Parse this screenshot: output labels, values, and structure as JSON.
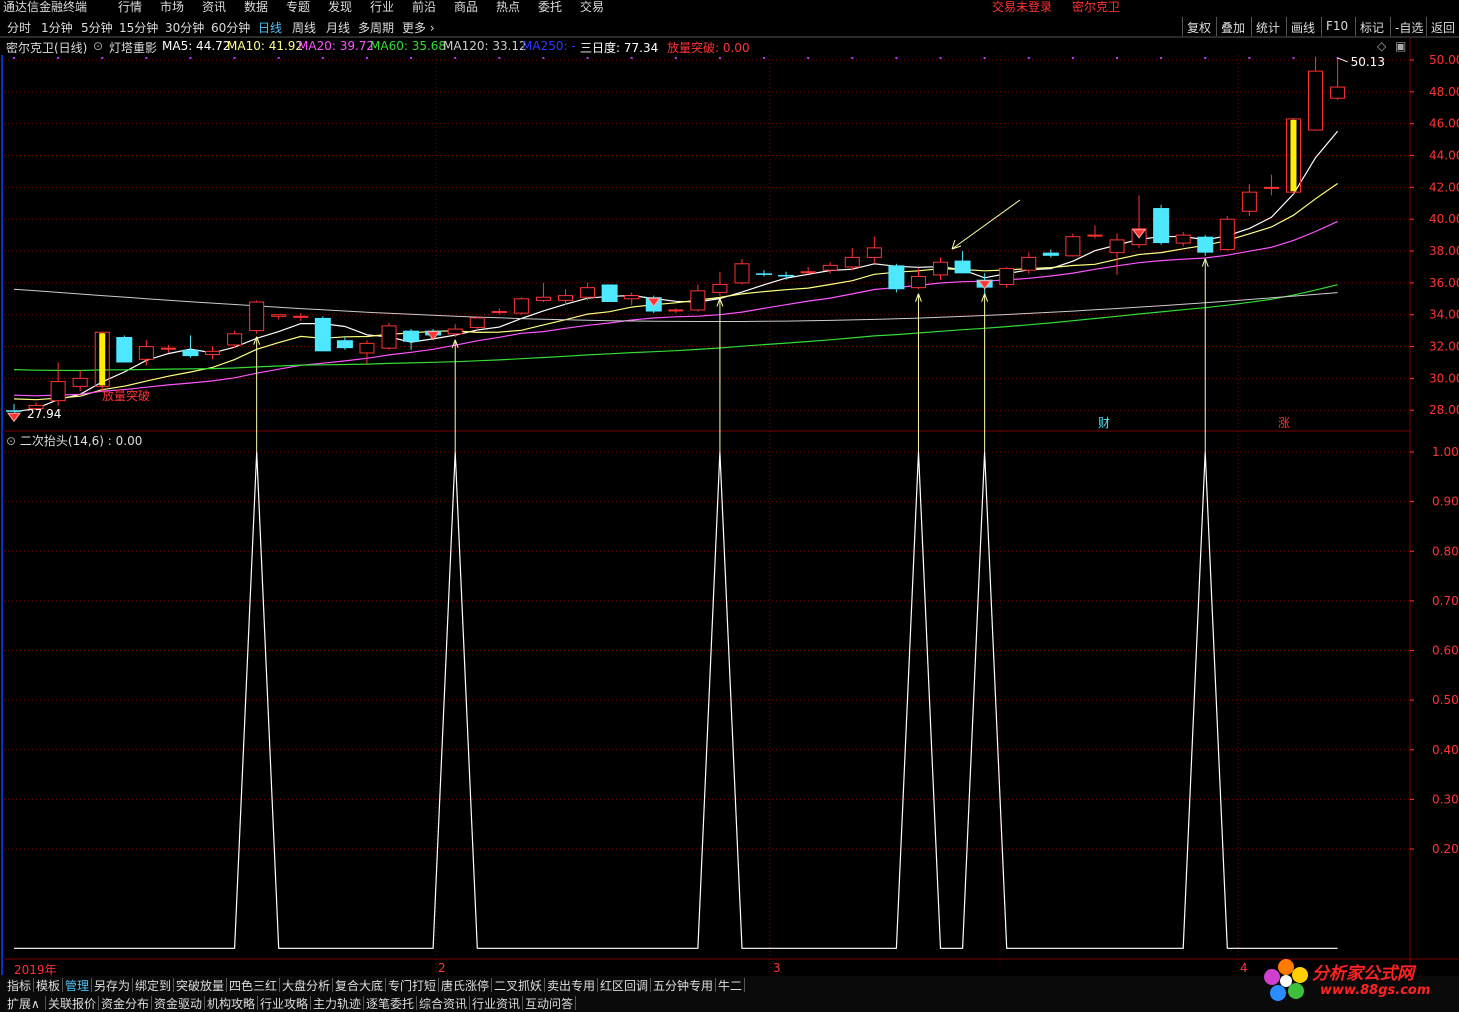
{
  "app": {
    "title": "通达信金融终端"
  },
  "menu": [
    "行情",
    "市场",
    "资讯",
    "数据",
    "专题",
    "发现",
    "行业",
    "前沿",
    "商品",
    "热点",
    "委托",
    "交易"
  ],
  "status": {
    "login": "交易未登录",
    "stock": "密尔克卫"
  },
  "periods": [
    "分时",
    "1分钟",
    "5分钟",
    "15分钟",
    "30分钟",
    "60分钟",
    "日线",
    "周线",
    "月线",
    "多周期",
    "更多 ›"
  ],
  "active_period": "日线",
  "right_tools": [
    "复权",
    "叠加",
    "统计",
    "画线",
    "F10",
    "标记",
    "-自选",
    "返回"
  ],
  "info": {
    "stock_label": "密尔克卫(日线)",
    "indicator_name": "灯塔重影",
    "ma5": "MA5: 44.72",
    "ma10": "MA10: 41.92",
    "ma20": "MA20: 39.72",
    "ma60": "MA60: 35.68",
    "ma120": "MA120: 33.12",
    "ma250": "MA250: -",
    "three_day": "三日度: 77.34",
    "breakout": "放量突破: 0.00"
  },
  "colors": {
    "ma5": "#ffffff",
    "ma10": "#ffff80",
    "ma20": "#ff55ff",
    "ma60": "#33dd33",
    "ma120": "#cccccc",
    "ma250": "#2b3bff",
    "up": "#ff3333",
    "down": "#4de8ff",
    "arrow": "#ffffaa",
    "grid": "#7a0000"
  },
  "main_chart": {
    "high_label": "50.13",
    "low_label": "27.94",
    "breakout_label": "放量突破",
    "cai_label": "财",
    "zhang_label": "涨"
  },
  "sub_chart": {
    "label": "二次抬头(14,6) : 0.00"
  },
  "time_axis": [
    "2019年",
    "2",
    "3",
    "4"
  ],
  "tabs_row1": [
    "指标",
    "模板",
    "管理",
    "另存为",
    "绑定到",
    "突破放量",
    "四色三红",
    "大盘分析",
    "复合大底",
    "专门打短",
    "唐氏涨停",
    "二叉抓妖",
    "卖出专用",
    "红区回调",
    "五分钟专用",
    "牛二"
  ],
  "tabs_row2": [
    "扩展∧",
    "关联报价",
    "资金分布",
    "资金驱动",
    "机构攻略",
    "行业攻略",
    "主力轨迹",
    "逐笔委托",
    "综合资讯",
    "行业资讯",
    "互动问答"
  ],
  "watermark": {
    "name": "分析家公式网",
    "url": "www.88gs.com"
  },
  "chart_data": [
    {
      "type": "candlestick",
      "ylim": [
        27,
        50.8
      ],
      "y_ticks": [
        "50.00",
        "48.00",
        "46.00",
        "44.00",
        "42.00",
        "40.00",
        "38.00",
        "36.00",
        "34.00",
        "32.00",
        "30.00",
        "28.00"
      ],
      "candles": [
        {
          "o": 28.0,
          "h": 28.4,
          "l": 27.94,
          "c": 27.9
        },
        {
          "o": 28.1,
          "h": 28.5,
          "l": 28.0,
          "c": 28.3
        },
        {
          "o": 28.6,
          "h": 31.0,
          "l": 28.3,
          "c": 29.8
        },
        {
          "o": 29.5,
          "h": 30.5,
          "l": 29.2,
          "c": 30.0
        },
        {
          "o": 29.5,
          "h": 32.9,
          "l": 29.2,
          "c": 32.9
        },
        {
          "o": 32.6,
          "h": 32.7,
          "l": 31.0,
          "c": 31.0
        },
        {
          "o": 31.2,
          "h": 32.4,
          "l": 30.8,
          "c": 32.0
        },
        {
          "o": 31.9,
          "h": 32.1,
          "l": 31.6,
          "c": 31.9
        },
        {
          "o": 31.8,
          "h": 32.7,
          "l": 31.3,
          "c": 31.4
        },
        {
          "o": 31.5,
          "h": 32.0,
          "l": 31.2,
          "c": 31.7
        },
        {
          "o": 32.1,
          "h": 33.0,
          "l": 31.9,
          "c": 32.8
        },
        {
          "o": 33.0,
          "h": 34.9,
          "l": 32.8,
          "c": 34.8
        },
        {
          "o": 33.9,
          "h": 33.9,
          "l": 33.7,
          "c": 34.0
        },
        {
          "o": 33.9,
          "h": 34.1,
          "l": 33.6,
          "c": 33.9
        },
        {
          "o": 33.8,
          "h": 33.9,
          "l": 31.7,
          "c": 31.7
        },
        {
          "o": 32.4,
          "h": 32.6,
          "l": 31.8,
          "c": 31.9
        },
        {
          "o": 31.6,
          "h": 32.4,
          "l": 30.9,
          "c": 32.2
        },
        {
          "o": 31.9,
          "h": 33.5,
          "l": 31.8,
          "c": 33.3
        },
        {
          "o": 33.0,
          "h": 33.1,
          "l": 31.8,
          "c": 32.3
        },
        {
          "o": 33.0,
          "h": 33.1,
          "l": 32.6,
          "c": 32.7
        },
        {
          "o": 32.8,
          "h": 33.4,
          "l": 32.6,
          "c": 33.1
        },
        {
          "o": 33.2,
          "h": 33.9,
          "l": 32.9,
          "c": 33.8
        },
        {
          "o": 34.2,
          "h": 34.4,
          "l": 34.0,
          "c": 34.2
        },
        {
          "o": 34.1,
          "h": 35.1,
          "l": 34.0,
          "c": 35.0
        },
        {
          "o": 34.9,
          "h": 36.0,
          "l": 34.8,
          "c": 35.1
        },
        {
          "o": 34.9,
          "h": 35.6,
          "l": 34.6,
          "c": 35.2
        },
        {
          "o": 35.1,
          "h": 36.0,
          "l": 34.9,
          "c": 35.7
        },
        {
          "o": 35.9,
          "h": 35.9,
          "l": 34.8,
          "c": 34.8
        },
        {
          "o": 35.0,
          "h": 35.4,
          "l": 34.6,
          "c": 35.2
        },
        {
          "o": 35.1,
          "h": 35.2,
          "l": 34.1,
          "c": 34.2
        },
        {
          "o": 34.3,
          "h": 34.4,
          "l": 34.1,
          "c": 34.3
        },
        {
          "o": 34.3,
          "h": 35.9,
          "l": 34.2,
          "c": 35.5
        },
        {
          "o": 35.4,
          "h": 36.7,
          "l": 35.2,
          "c": 35.9
        },
        {
          "o": 36.0,
          "h": 37.5,
          "l": 35.9,
          "c": 37.2
        },
        {
          "o": 36.6,
          "h": 36.8,
          "l": 36.4,
          "c": 36.5
        },
        {
          "o": 36.5,
          "h": 36.7,
          "l": 36.2,
          "c": 36.4
        },
        {
          "o": 36.7,
          "h": 37.0,
          "l": 36.6,
          "c": 36.7
        },
        {
          "o": 36.8,
          "h": 37.3,
          "l": 36.6,
          "c": 37.1
        },
        {
          "o": 37.0,
          "h": 38.2,
          "l": 36.8,
          "c": 37.6
        },
        {
          "o": 37.6,
          "h": 38.9,
          "l": 37.2,
          "c": 38.2
        },
        {
          "o": 37.1,
          "h": 37.2,
          "l": 35.4,
          "c": 35.6
        },
        {
          "o": 35.7,
          "h": 36.9,
          "l": 35.6,
          "c": 36.4
        },
        {
          "o": 36.5,
          "h": 37.6,
          "l": 36.2,
          "c": 37.3
        },
        {
          "o": 37.4,
          "h": 38.0,
          "l": 36.7,
          "c": 36.6
        },
        {
          "o": 36.2,
          "h": 36.6,
          "l": 35.2,
          "c": 35.7
        },
        {
          "o": 35.9,
          "h": 37.0,
          "l": 35.7,
          "c": 36.9
        },
        {
          "o": 36.8,
          "h": 37.9,
          "l": 36.6,
          "c": 37.6
        },
        {
          "o": 37.9,
          "h": 38.1,
          "l": 37.6,
          "c": 37.7
        },
        {
          "o": 37.7,
          "h": 39.1,
          "l": 37.7,
          "c": 38.9
        },
        {
          "o": 39.0,
          "h": 39.6,
          "l": 38.8,
          "c": 39.0
        },
        {
          "o": 37.9,
          "h": 39.1,
          "l": 36.5,
          "c": 38.7
        },
        {
          "o": 38.4,
          "h": 41.5,
          "l": 38.2,
          "c": 39.4
        },
        {
          "o": 40.7,
          "h": 40.9,
          "l": 38.4,
          "c": 38.5
        },
        {
          "o": 38.5,
          "h": 39.2,
          "l": 38.3,
          "c": 39.0
        },
        {
          "o": 38.9,
          "h": 39.0,
          "l": 37.7,
          "c": 37.9
        },
        {
          "o": 38.1,
          "h": 40.2,
          "l": 38.0,
          "c": 40.0
        },
        {
          "o": 40.5,
          "h": 42.2,
          "l": 40.2,
          "c": 41.7
        },
        {
          "o": 42.0,
          "h": 42.8,
          "l": 41.5,
          "c": 42.0
        },
        {
          "o": 41.7,
          "h": 46.3,
          "l": 41.6,
          "c": 46.3
        },
        {
          "o": 45.6,
          "h": 50.2,
          "l": 45.6,
          "c": 49.3
        },
        {
          "o": 47.6,
          "h": 50.13,
          "l": 47.5,
          "c": 48.3
        }
      ],
      "signal_candles": [
        4,
        58
      ],
      "diamonds": [
        0,
        19,
        29,
        44,
        51
      ]
    },
    {
      "type": "line",
      "title": "二次抬头(14,6)",
      "ylim": [
        0.05,
        1.05
      ],
      "y_ticks": [
        "1.00",
        "0.90",
        "0.80",
        "0.70",
        "0.60",
        "0.50",
        "0.40",
        "0.30",
        "0.20"
      ],
      "values": [
        0,
        0,
        0,
        0,
        0,
        0,
        0,
        0,
        0,
        0,
        0,
        1,
        0,
        0,
        0,
        0,
        0,
        0,
        0,
        0,
        1,
        0,
        0,
        0,
        0,
        0,
        0,
        0,
        0,
        0,
        0,
        0,
        1,
        0,
        0,
        0,
        0,
        0,
        0,
        0,
        0,
        1,
        0,
        0,
        1,
        0,
        0,
        0,
        0,
        0,
        0,
        0,
        0,
        0,
        1,
        0,
        0,
        0,
        0,
        0,
        0
      ]
    }
  ]
}
